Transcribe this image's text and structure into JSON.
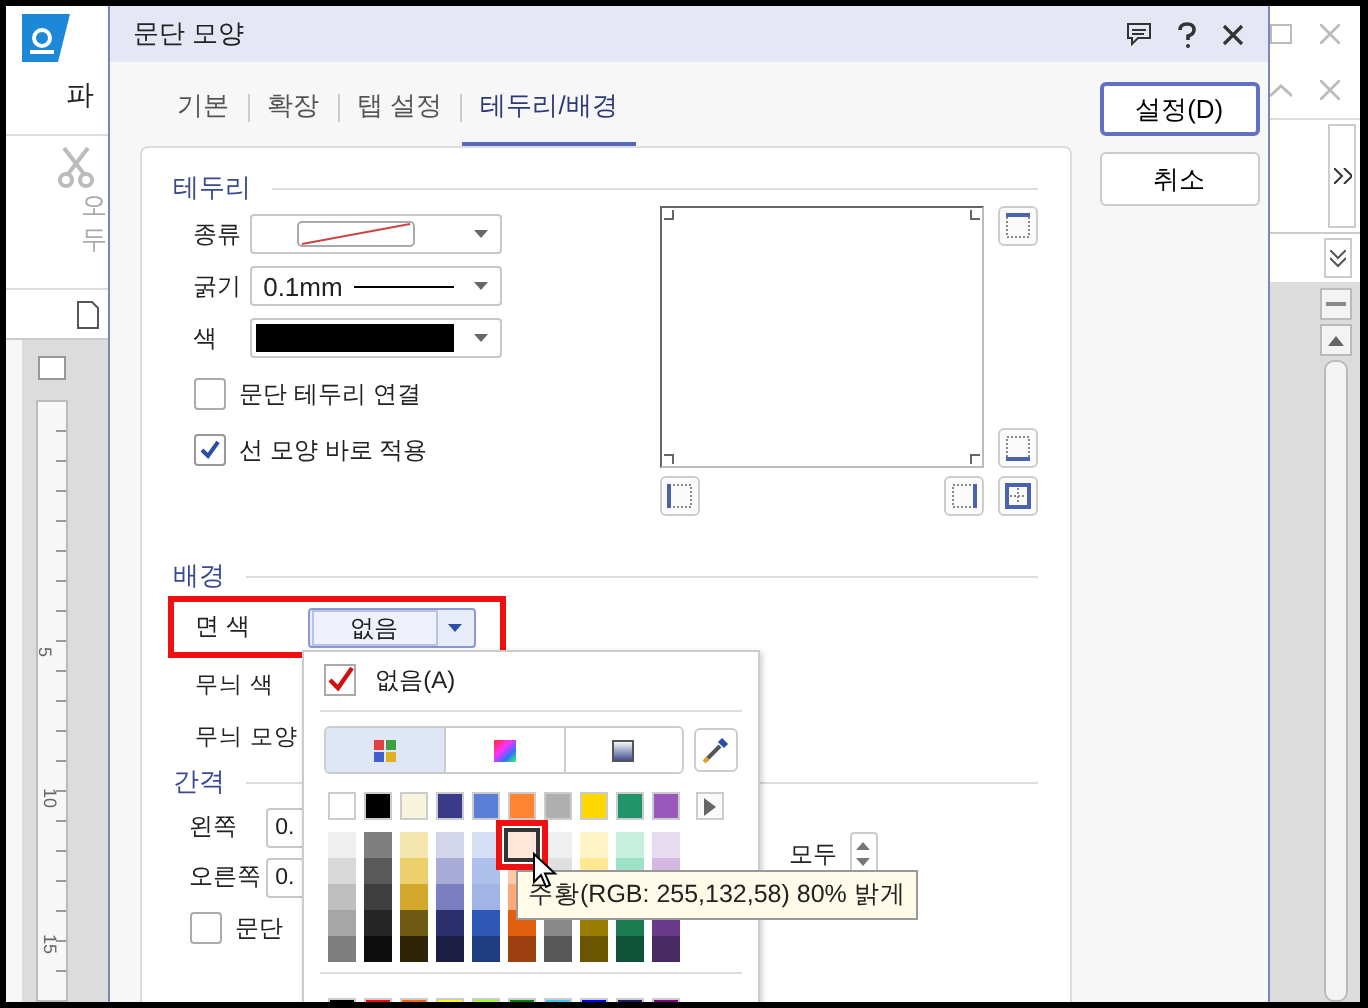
{
  "app": {
    "menu_partial": "파",
    "ribbon_partial": [
      "오",
      "두"
    ],
    "ruler_labels": [
      "5",
      "10",
      "15"
    ]
  },
  "dialog": {
    "title": "문단 모양"
  },
  "tabs": [
    {
      "label": "기본",
      "selected": false
    },
    {
      "label": "확장",
      "selected": false
    },
    {
      "label": "탭 설정",
      "selected": false
    },
    {
      "label": "테두리/배경",
      "selected": true
    }
  ],
  "buttons": [
    {
      "label": "설정(D)",
      "default": true
    },
    {
      "label": "취소",
      "default": false
    }
  ],
  "border": {
    "heading": "테두리",
    "type_label": "종류",
    "width_label": "굵기",
    "width_value": "0.1mm",
    "color_label": "색",
    "checkboxes": [
      {
        "label": "문단 테두리 연결",
        "checked": false
      },
      {
        "label": "선 모양 바로 적용",
        "checked": true
      }
    ]
  },
  "background": {
    "heading": "배경",
    "fill_label": "면 색",
    "fill_value": "없음",
    "pattern_color_label": "무늬 색",
    "pattern_shape_label": "무늬 모양"
  },
  "spacing": {
    "heading": "간격",
    "left_label": "왼쪽",
    "left_value": "0.",
    "right_label": "오른쪽",
    "right_value": "0.",
    "all_label": "모두",
    "checkbox": {
      "label": "문단",
      "checked": false
    }
  },
  "color_popup": {
    "none_option": "없음(A)",
    "none_checked": true,
    "modes": [
      {
        "kind": "palette",
        "selected": true
      },
      {
        "kind": "spectrum",
        "selected": false
      },
      {
        "kind": "gradient",
        "selected": false
      }
    ],
    "theme_row": [
      {
        "color": "#ffffff"
      },
      {
        "color": "#000000"
      },
      {
        "color": "#f8f3dc"
      },
      {
        "color": "#3a3a8a"
      },
      {
        "color": "#5a7fd6"
      },
      {
        "color": "#ff8432"
      },
      {
        "color": "#b0b0b0"
      },
      {
        "color": "#ffd700"
      },
      {
        "color": "#22946a"
      },
      {
        "color": "#9b59c0"
      }
    ],
    "shade_rows": [
      {
        "swatches": [
          {
            "color": "#efefef",
            "selected": false
          },
          {
            "color": "#7f7f7f",
            "selected": false
          },
          {
            "color": "#f5e6b0",
            "selected": false
          },
          {
            "color": "#d3d5ea",
            "selected": false
          },
          {
            "color": "#d5dff5",
            "selected": false
          },
          {
            "color": "#ffe6d8",
            "selected": true
          },
          {
            "color": "#efefef",
            "selected": false
          },
          {
            "color": "#fff4c8",
            "selected": false
          },
          {
            "color": "#c8eede",
            "selected": false
          },
          {
            "color": "#e8dcf0",
            "selected": false
          }
        ]
      },
      {
        "swatches": [
          {
            "color": "#d9d9d9",
            "selected": false
          },
          {
            "color": "#595959",
            "selected": false
          },
          {
            "color": "#ecd06b",
            "selected": false
          },
          {
            "color": "#a7abd6",
            "selected": false
          },
          {
            "color": "#adc0ec",
            "selected": false
          },
          {
            "color": "#ffc8a8",
            "selected": false
          },
          {
            "color": "#dfdfdf",
            "selected": false
          },
          {
            "color": "#ffe890",
            "selected": false
          },
          {
            "color": "#9de2c6",
            "selected": false
          },
          {
            "color": "#d2b8e2",
            "selected": false
          }
        ]
      },
      {
        "swatches": [
          {
            "color": "#bfbfbf",
            "selected": false
          },
          {
            "color": "#3f3f3f",
            "selected": false
          },
          {
            "color": "#d4a82a",
            "selected": false
          },
          {
            "color": "#7a7fc1",
            "selected": false
          },
          {
            "color": "#a0b4e6",
            "selected": false
          },
          {
            "color": "#ffa878",
            "selected": false
          }
        ]
      },
      {
        "swatches": [
          {
            "color": "#a6a6a6",
            "selected": false
          },
          {
            "color": "#262626",
            "selected": false
          },
          {
            "color": "#6e5a12",
            "selected": false
          },
          {
            "color": "#2b2f6b",
            "selected": false
          },
          {
            "color": "#2e58b8",
            "selected": false
          },
          {
            "color": "#e06010",
            "selected": false
          },
          {
            "color": "#888888",
            "selected": false
          },
          {
            "color": "#9a7c00",
            "selected": false
          },
          {
            "color": "#1a7a50",
            "selected": false
          },
          {
            "color": "#6a3a8a",
            "selected": false
          }
        ]
      },
      {
        "swatches": [
          {
            "color": "#7f7f7f",
            "selected": false
          },
          {
            "color": "#0d0d0d",
            "selected": false
          },
          {
            "color": "#2e2508",
            "selected": false
          },
          {
            "color": "#1b1d42",
            "selected": false
          },
          {
            "color": "#1e3d80",
            "selected": false
          },
          {
            "color": "#9c4010",
            "selected": false
          },
          {
            "color": "#585858",
            "selected": false
          },
          {
            "color": "#6a5600",
            "selected": false
          },
          {
            "color": "#105238",
            "selected": false
          },
          {
            "color": "#4a2a62",
            "selected": false
          }
        ]
      }
    ],
    "standard_row": [
      {
        "color": "#000000"
      },
      {
        "color": "#ff0000"
      },
      {
        "color": "#ff6600"
      },
      {
        "color": "#ffff00"
      },
      {
        "color": "#a0ff20"
      },
      {
        "color": "#008000"
      },
      {
        "color": "#33ccff"
      },
      {
        "color": "#0000ff"
      },
      {
        "color": "#1a1a60"
      },
      {
        "color": "#800080"
      }
    ],
    "tooltip": "주황(RGB: 255,132,58) 80% 밝게"
  }
}
